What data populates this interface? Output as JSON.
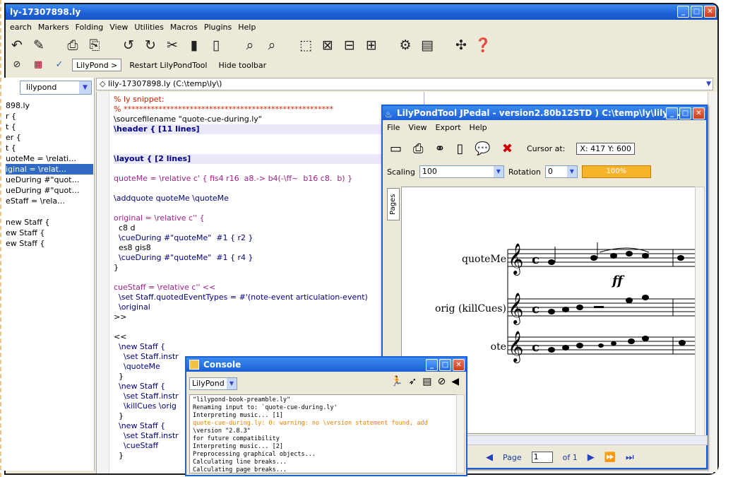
{
  "main_window": {
    "title": "ly-17307898.ly",
    "menu": [
      "earch",
      "Markers",
      "Folding",
      "View",
      "Utilities",
      "Macros",
      "Plugins",
      "Help"
    ],
    "toolbar_icons": [
      "undo-icon",
      "pen-icon",
      "print-icon",
      "print-preview-icon",
      "undo-arc-icon",
      "redo-arc-icon",
      "cut-icon",
      "copy-icon",
      "paste-icon",
      "find-icon",
      "find-next-icon",
      "select-icon",
      "zoom-icon",
      "split-icon",
      "columns-icon",
      "settings-icon",
      "plugin-icon",
      "help-icon"
    ],
    "toolbar2": {
      "lilypond_button": "LilyPond >",
      "restart_button": "Restart LilyPondTool",
      "hide_toolbar": "Hide toolbar"
    }
  },
  "sidebar": {
    "mode_select": "lilypond",
    "items": [
      {
        "label": "898.ly",
        "selected": false
      },
      {
        "label": "r {",
        "selected": false
      },
      {
        "label": "t {",
        "selected": false
      },
      {
        "label": "er {",
        "selected": false
      },
      {
        "label": "t {",
        "selected": false
      },
      {
        "label": "uoteMe = \\relati…",
        "selected": false
      },
      {
        "label": "iginal = \\relat…",
        "selected": true
      },
      {
        "label": "ueDuring #\"quot…",
        "selected": false
      },
      {
        "label": "ueDuring #\"quot…",
        "selected": false
      },
      {
        "label": "eStaff = \\rela…",
        "selected": false
      },
      {
        "label": "",
        "selected": false
      },
      {
        "label": "new Staff {",
        "selected": false
      },
      {
        "label": "ew Staff {",
        "selected": false
      },
      {
        "label": "ew Staff {",
        "selected": false
      }
    ]
  },
  "path_bar": "◇ lily-17307898.ly (C:\\temp\\ly\\)",
  "code_lines": [
    "% ly snippet:",
    "% ******************************************************",
    "\\sourcefilename \"quote-cue-during.ly\"",
    "\\header { [11 lines]",
    "",
    "",
    "\\layout { [2 lines]",
    "",
    "quoteMe = \\relative c' { fis4 r16  a8.-> b4(-\\ff~  b16 c8.  b) }",
    "",
    "\\addquote quoteMe \\quoteMe",
    "",
    "original = \\relative c'' {",
    "  c8 d",
    "  \\cueDuring #\"quoteMe\"  #1 { r2 }",
    "  es8 gis8",
    "  \\cueDuring #\"quoteMe\"  #1 { r4 }",
    "}",
    "",
    "cueStaff = \\relative c'' <<",
    "  \\set Staff.quotedEventTypes = #'(note-event articulation-event)",
    "  \\original",
    ">>",
    "",
    "<<",
    "  \\new Staff {",
    "    \\set Staff.instr",
    "    \\quoteMe",
    "  }",
    "  \\new Staff {",
    "    \\set Staff.instr",
    "    \\killCues \\orig",
    "  }",
    "  \\new Staff {",
    "    \\set Staff.instr",
    "    \\cueStaff",
    "  }"
  ],
  "jpedal": {
    "title": "LilyPondTool JPedal - version2.80b12STD ) C:\\temp\\ly\\lily-…",
    "menu": [
      "File",
      "View",
      "Export",
      "Help"
    ],
    "cursor_label": "Cursor at:",
    "cursor_value": "X: 417 Y: 600",
    "scaling_label": "Scaling",
    "scaling_value": "100",
    "rotation_label": "Rotation",
    "rotation_value": "0",
    "progress_label": "100%",
    "progress": 1.0,
    "pages_tab": "Pages",
    "staff_labels": [
      "quoteMe",
      "orig (killCues)",
      "ote"
    ],
    "dynamic": "ff",
    "page_label": "Page",
    "page_value": "1",
    "page_of": "of 1"
  },
  "console": {
    "title": "Console",
    "select": "LilyPond",
    "lines": [
      {
        "text": "    \"lilypond-book-preamble.ly\"",
        "warn": false
      },
      {
        "text": "Renaming input to: `quote-cue-during.ly'",
        "warn": false
      },
      {
        "text": "Interpreting music... [1]",
        "warn": false
      },
      {
        "text": "quote-cue-during.ly: 0: warning: no \\version statement found, add",
        "warn": true
      },
      {
        "text": "\\version \"2.8.3\"",
        "warn": false
      },
      {
        "text": "for future compatibility",
        "warn": false
      },
      {
        "text": "Interpreting music... [2]",
        "warn": false
      },
      {
        "text": "Preprocessing graphical objects...",
        "warn": false
      },
      {
        "text": "Calculating line breaks...",
        "warn": false
      },
      {
        "text": "Calculating page breaks...",
        "warn": false
      }
    ]
  }
}
